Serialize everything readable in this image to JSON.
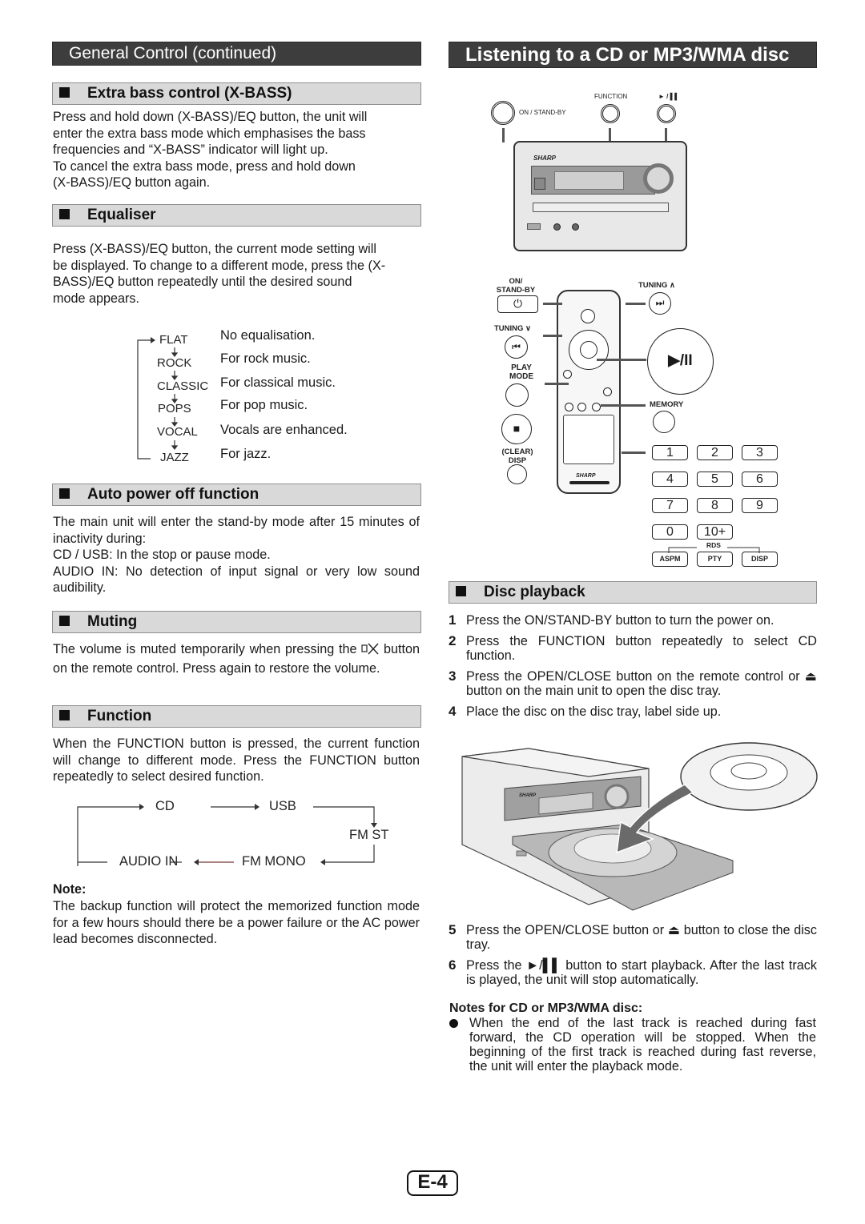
{
  "left": {
    "banner": "General Control (continued)",
    "sections": {
      "xbass": {
        "heading": "Extra bass control (X-BASS)",
        "lines": [
          "Press and hold down (X-BASS)/EQ button, the unit will",
          "enter the extra bass mode which emphasises the bass",
          "frequencies and “X-BASS” indicator will light up.",
          "To cancel the extra bass mode, press and hold down",
          "(X-BASS)/EQ button again."
        ]
      },
      "equaliser": {
        "heading": "Equaliser",
        "lines": [
          "Press (X-BASS)/EQ button, the current mode setting will",
          "be displayed. To change to a different mode, press the (X-",
          "BASS)/EQ  button repeatedly until the desired sound",
          "mode appears."
        ],
        "modes": [
          {
            "name": "FLAT",
            "desc": "No equalisation."
          },
          {
            "name": "ROCK",
            "desc": "For rock music."
          },
          {
            "name": "CLASSIC",
            "desc": "For classical music."
          },
          {
            "name": "POPS",
            "desc": "For pop music."
          },
          {
            "name": "VOCAL",
            "desc": "Vocals are enhanced."
          },
          {
            "name": "JAZZ",
            "desc": "For jazz."
          }
        ]
      },
      "autopower": {
        "heading": "Auto power off function",
        "para1": "The main unit will enter the stand-by mode after 15 minutes of inactivity during:",
        "line2": "CD / USB: In the stop or pause mode.",
        "para3": "AUDIO IN: No detection of input signal or very low sound audibility."
      },
      "muting": {
        "heading": "Muting",
        "text_before": "The volume is muted temporarily when pressing the",
        "text_after": "button on the remote control. Press again to restore the volume.",
        "icon": "mute-speaker-icon"
      },
      "function": {
        "heading": "Function",
        "text": "When the FUNCTION button is pressed, the current function will change to different mode. Press the FUNCTION button repeatedly to select desired function.",
        "cycle": [
          "CD",
          "USB",
          "FM ST",
          "FM MONO",
          "AUDIO IN"
        ]
      },
      "note": {
        "label": "Note:",
        "text": "The backup function will protect the memorized function mode for a few hours should there be a power failure or the AC power lead becomes disconnected."
      }
    }
  },
  "right": {
    "banner": "Listening to a CD or MP3/WMA disc",
    "unit_labels": {
      "on_standby": "ON / STAND-BY",
      "function": "FUNCTION",
      "play_pause": "► / ▌▌",
      "brand": "SHARP"
    },
    "remote_labels": {
      "on_standby": [
        "ON/",
        "STAND-BY"
      ],
      "tuning_up": "TUNING ∧",
      "tuning_down": "TUNING ∨",
      "play_mode": [
        "PLAY",
        "MODE"
      ],
      "clear_disp": [
        "(CLEAR)",
        "DISP"
      ],
      "memory": "MEMORY",
      "rds": "RDS",
      "play_pause_glyph": "▶/II",
      "stop_glyph": "■",
      "power_glyph": "⏻",
      "next_glyph": "⏭",
      "prev_glyph": "⏮",
      "brand": "SHARP"
    },
    "keypad": [
      "1",
      "2",
      "3",
      "4",
      "5",
      "6",
      "7",
      "8",
      "9",
      "0",
      "10+"
    ],
    "rds_keys": [
      "ASPM",
      "PTY",
      "DISP"
    ],
    "disc_playback": {
      "heading": "Disc playback",
      "steps": [
        {
          "n": "1",
          "text": "Press the ON/STAND-BY button to turn the power on."
        },
        {
          "n": "2",
          "text": "Press the FUNCTION button repeatedly to select CD function."
        },
        {
          "n": "3",
          "text": "Press the OPEN/CLOSE button on the remote control or ⏏ button on the main unit to open the disc tray."
        },
        {
          "n": "4",
          "text": "Place the disc on the disc tray, label side up."
        },
        {
          "n": "5",
          "text": "Press the OPEN/CLOSE button or ⏏ button to close the disc tray."
        },
        {
          "n": "6",
          "text": "Press the ►/▌▌ button to start playback. After the last track is played, the unit will stop automatically."
        }
      ]
    },
    "notes": {
      "heading": "Notes for CD or MP3/WMA disc:",
      "bullet": "When the end of the last track is reached during fast forward, the CD operation will be stopped. When the beginning of the first track is reached during fast reverse, the unit will enter the playback mode."
    }
  },
  "footer": {
    "page": "E-4"
  }
}
